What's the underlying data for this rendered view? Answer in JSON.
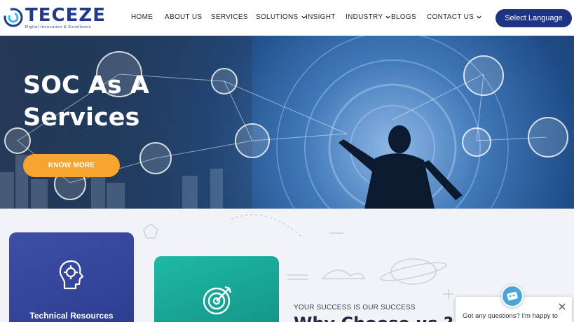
{
  "header": {
    "logo_name": "TECEZE",
    "logo_tagline": "Digital Innovation & Excellence",
    "nav": [
      {
        "label": "HOME",
        "has_dropdown": false
      },
      {
        "label": "ABOUT US",
        "has_dropdown": false
      },
      {
        "label": "SERVICES",
        "has_dropdown": false
      },
      {
        "label": "SOLUTIONS",
        "has_dropdown": true
      },
      {
        "label": "INSIGHT",
        "has_dropdown": false
      },
      {
        "label": "INDUSTRY",
        "has_dropdown": true
      },
      {
        "label": "BLOGS",
        "has_dropdown": false
      },
      {
        "label": "CONTACT US",
        "has_dropdown": true
      }
    ],
    "language_button": "Select Language"
  },
  "hero": {
    "title_line1": "SOC As A",
    "title_line2": "Services",
    "cta": "KNOW MORE"
  },
  "cards": [
    {
      "title": "Technical Resources",
      "icon": "brain-gear-icon"
    },
    {
      "title": "",
      "icon": "target-icon"
    }
  ],
  "why": {
    "tagline": "YOUR SUCCESS IS OUR SUCCESS",
    "heading": "Why Choose us ?"
  },
  "chat": {
    "message": "Got any questions? I'm happy to"
  },
  "colors": {
    "brand_navy": "#1e3483",
    "accent_orange": "#f7a531",
    "card_blue": "#3d4fa6",
    "card_teal": "#1fb8a6"
  }
}
